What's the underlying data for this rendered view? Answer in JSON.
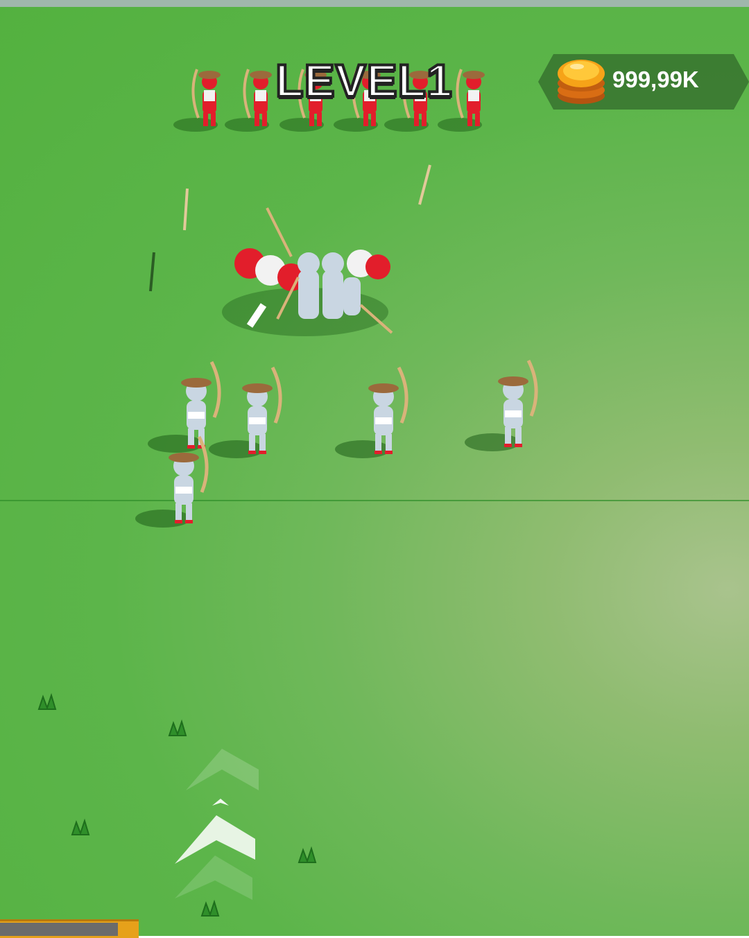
{
  "hud": {
    "level_label": "LEVEL1",
    "coin_amount": "999,99K",
    "coin_icon": "gold-coin-stack-icon"
  },
  "scene": {
    "ground_color": "#53b13f",
    "enemy_color": "#e21e2b",
    "ally_color": "#c9d6e2",
    "hat_color": "#9b6a3c"
  },
  "controls": {
    "advance_icon": "chevron-up-icon"
  }
}
